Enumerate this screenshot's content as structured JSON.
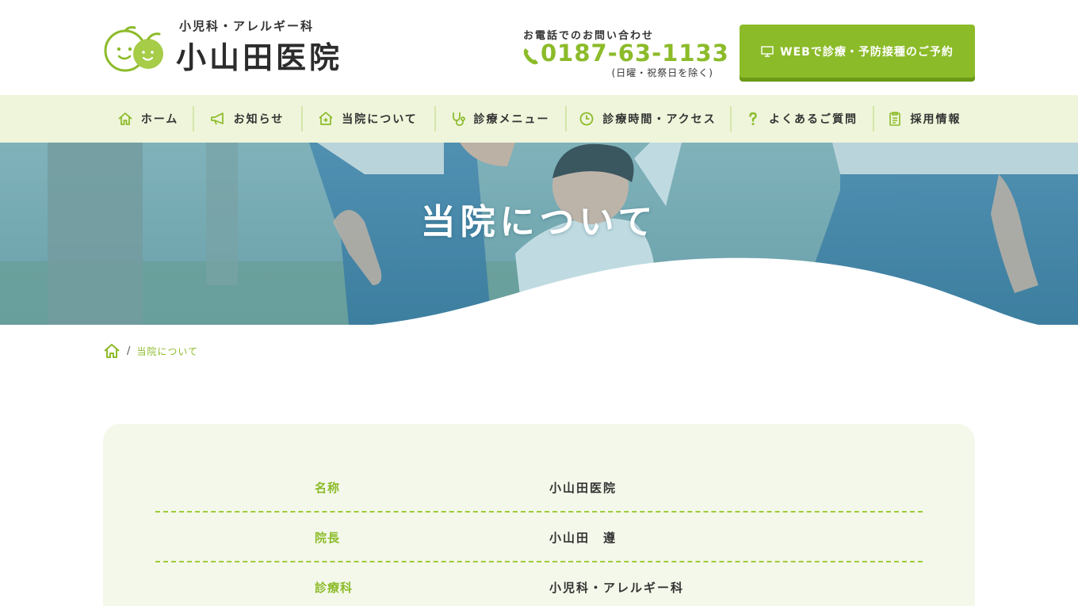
{
  "colors": {
    "accent": "#8cbb2a",
    "nav_bg": "#eef5da",
    "card_bg": "#f4f8ea"
  },
  "header": {
    "logo_sub": "小児科・アレルギー科",
    "logo_main": "小山田医院",
    "contact_label": "お電話でのお問い合わせ",
    "phone": "0187-63-1133",
    "phone_note": "(日曜・祝祭日を除く)",
    "reserve_label": "WEBで診療・予防接種のご予約",
    "reserve_icon": "monitor-icon"
  },
  "nav": {
    "items": [
      {
        "label": "ホーム",
        "icon": "home-icon"
      },
      {
        "label": "お知らせ",
        "icon": "megaphone-icon"
      },
      {
        "label": "当院について",
        "icon": "house-plus-icon"
      },
      {
        "label": "診療メニュー",
        "icon": "stethoscope-icon"
      },
      {
        "label": "診療時間・アクセス",
        "icon": "clock-icon"
      },
      {
        "label": "よくあるご質問",
        "icon": "question-icon"
      },
      {
        "label": "採用情報",
        "icon": "clipboard-icon"
      }
    ]
  },
  "hero": {
    "title": "当院について"
  },
  "breadcrumb": {
    "separator": "/",
    "current": "当院について"
  },
  "info": {
    "rows": [
      {
        "label": "名称",
        "value": "小山田医院"
      },
      {
        "label": "院長",
        "value": "小山田　遵"
      },
      {
        "label": "診療科",
        "value": "小児科・アレルギー科"
      }
    ]
  }
}
